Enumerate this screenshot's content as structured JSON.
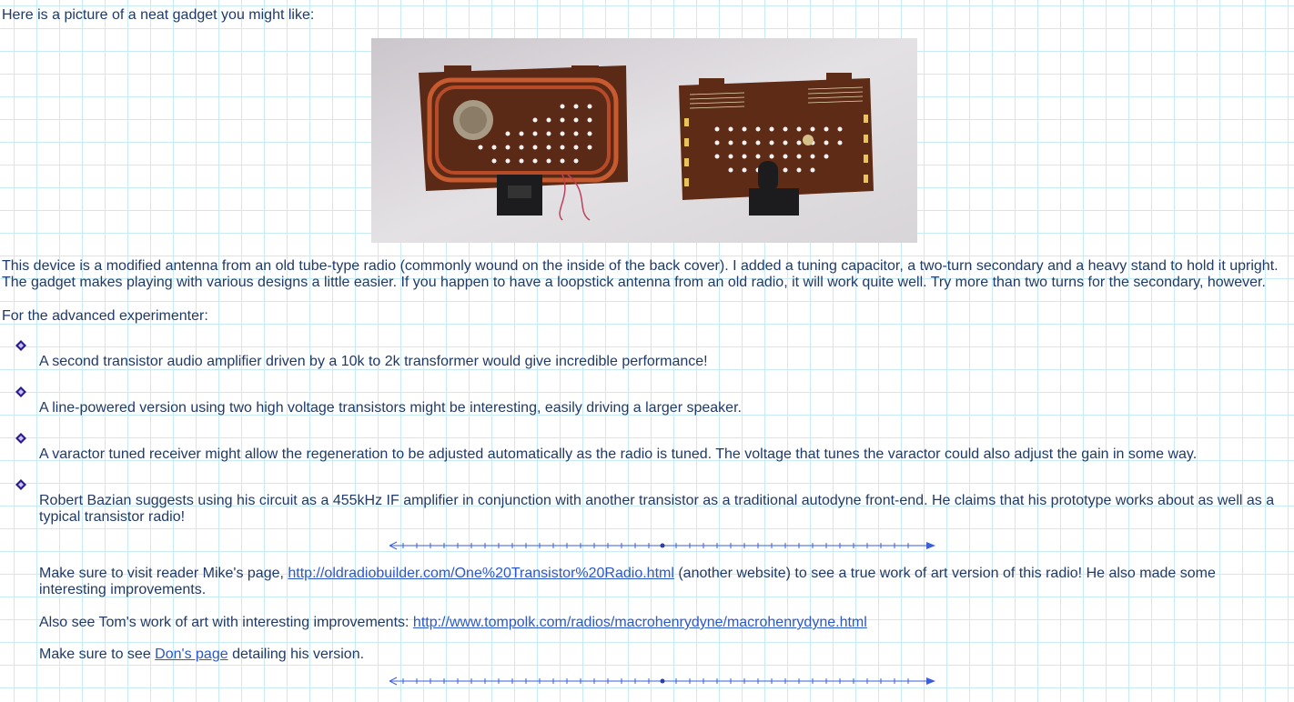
{
  "intro": "Here is a picture of a neat gadget you might like:",
  "description": "This device is a modified antenna from an old tube-type radio (commonly wound on the inside of the back cover). I added a tuning capacitor, a two-turn secondary and a heavy stand to hold it upright. The gadget makes playing with various designs a little easier. If you happen to have a loopstick antenna from an old radio, it will work quite well. Try more than two turns for the secondary, however.",
  "advanced_heading": "For the advanced experimenter:",
  "bullets": [
    "A second transistor audio amplifier driven by a 10k to 2k transformer would give incredible performance!",
    "A line-powered version using two high voltage transistors might be interesting, easily driving a larger speaker.",
    "A varactor tuned receiver might allow the regeneration to be adjusted automatically as the radio is tuned. The voltage that tunes the varactor could also adjust the gain in some way.",
    "Robert Bazian suggests using his circuit as a 455kHz IF amplifier in conjunction with another transistor as a traditional autodyne front-end. He claims that his prototype works about as well as a typical transistor radio!"
  ],
  "mike": {
    "before": "Make sure to visit reader Mike's page, ",
    "link": "http://oldradiobuilder.com/One%20Transistor%20Radio.html",
    "after": " (another website) to see a true work of art version of this radio! He also made some interesting improvements."
  },
  "tom": {
    "before": "Also see Tom's work of art with interesting improvements: ",
    "link": "http://www.tompolk.com/radios/macrohenrydyne/macrohenrydyne.html"
  },
  "don": {
    "before": "Make sure to see ",
    "link": "Don's page",
    "after": " detailing his version."
  },
  "colors": {
    "text": "#1f3a68",
    "link": "#2a57c9",
    "grid": "#c7ecf6",
    "bullet": "#2a1a8a",
    "divider": "#3a5fd8"
  },
  "photo_icon": "gadget-photo"
}
